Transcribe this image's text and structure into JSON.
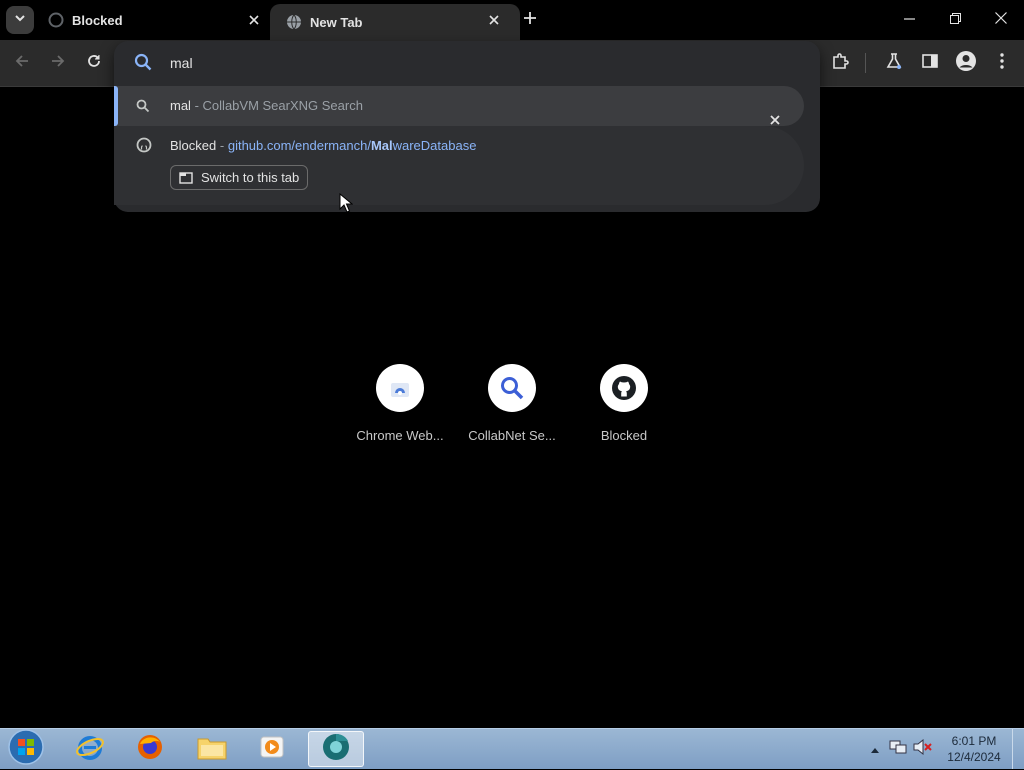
{
  "tabs": [
    {
      "title": "Blocked",
      "active": false
    },
    {
      "title": "New Tab",
      "active": true
    }
  ],
  "omnibox": {
    "input_value": "mal",
    "suggestions": [
      {
        "query": "mal",
        "separator": "-",
        "description": "CollabVM SearXNG Search"
      },
      {
        "title": "Blocked",
        "separator": "-",
        "url_prefix": "github.com/endermanch/",
        "url_match": "Mal",
        "url_suffix": "wareDatabase",
        "action_label": "Switch to this tab"
      }
    ]
  },
  "shortcuts": [
    {
      "label": "Chrome Web..."
    },
    {
      "label": "CollabNet Se..."
    },
    {
      "label": "Blocked"
    }
  ],
  "taskbar": {
    "clock_time": "6:01 PM",
    "clock_date": "12/4/2024"
  },
  "colors": {
    "accent": "#8ab4f8",
    "dropdown_bg": "#2a2b2e",
    "toolbar_bg": "#2b2b2b"
  },
  "icons": [
    "tab-search-icon",
    "github-icon",
    "globe-icon",
    "close-icon",
    "plus-icon",
    "minimize-icon",
    "restore-icon",
    "back-arrow-icon",
    "forward-arrow-icon",
    "reload-icon",
    "search-icon",
    "extensions-icon",
    "labs-flask-icon",
    "side-panel-icon",
    "profile-icon",
    "menu-dots-icon",
    "tab-icon",
    "windows-start-icon",
    "internet-explorer-icon",
    "firefox-icon",
    "file-explorer-icon",
    "media-player-icon",
    "chromium-icon"
  ]
}
